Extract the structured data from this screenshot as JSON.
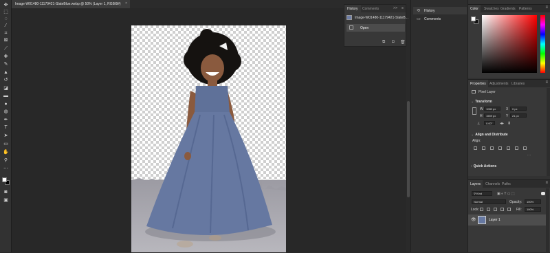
{
  "document": {
    "tab_title": "Image-W01480-11179421-SlateBlue.webp @ 50% (Layer 1, RGB/8#)",
    "close_glyph": "×"
  },
  "toolbar": {
    "tools": [
      "move-icon",
      "marquee-icon",
      "lasso-icon",
      "magic-wand-icon",
      "crop-icon",
      "frame-icon",
      "eyedropper-icon",
      "healing-brush-icon",
      "brush-icon",
      "clone-stamp-icon",
      "history-brush-icon",
      "eraser-icon",
      "gradient-icon",
      "blur-icon",
      "dodge-icon",
      "pen-icon",
      "type-icon",
      "path-selection-icon",
      "rectangle-icon",
      "hand-icon",
      "zoom-icon",
      "more-tools-icon"
    ]
  },
  "history_panel": {
    "tabs": [
      "History",
      "Comments"
    ],
    "active_tab": "History",
    "snapshot_label": "Image-W01480-11179421-SlateB...",
    "states": [
      "Open"
    ],
    "controls": {
      "expand": ">>",
      "menu": "≡"
    }
  },
  "collapsed_column": {
    "buttons": [
      {
        "label": "History",
        "icon": "history-icon"
      },
      {
        "label": "Comments",
        "icon": "comments-icon"
      }
    ]
  },
  "color_panel": {
    "tabs": [
      "Color",
      "Swatches",
      "Gradients",
      "Patterns"
    ],
    "active_tab": "Color"
  },
  "properties_panel": {
    "tabs": [
      "Properties",
      "Adjustments",
      "Libraries"
    ],
    "active_tab": "Properties",
    "layer_type": "Pixel Layer",
    "transform": {
      "heading": "Transform",
      "w_label": "W",
      "w_value": "1080 px",
      "h_label": "H",
      "h_value": "1559 px",
      "x_label": "X",
      "x_value": "0 px",
      "y_label": "Y",
      "y_value": "21 px",
      "angle_value": "0.00°"
    },
    "align": {
      "heading": "Align and Distribute",
      "sub": "Align:"
    },
    "quick_actions": {
      "heading": "Quick Actions"
    }
  },
  "layers_panel": {
    "tabs": [
      "Layers",
      "Channels",
      "Paths"
    ],
    "active_tab": "Layers",
    "filter_label": "Kind",
    "blend_mode": "Normal",
    "opacity_label": "Opacity:",
    "opacity_value": "100%",
    "lock_label": "Lock:",
    "fill_label": "Fill:",
    "fill_value": "100%",
    "layers": [
      {
        "name": "Layer 1",
        "visible": true
      }
    ]
  },
  "colors": {
    "accent": "#5b6e94",
    "dress": "#6678a1",
    "hue_red": "#ff0000"
  }
}
